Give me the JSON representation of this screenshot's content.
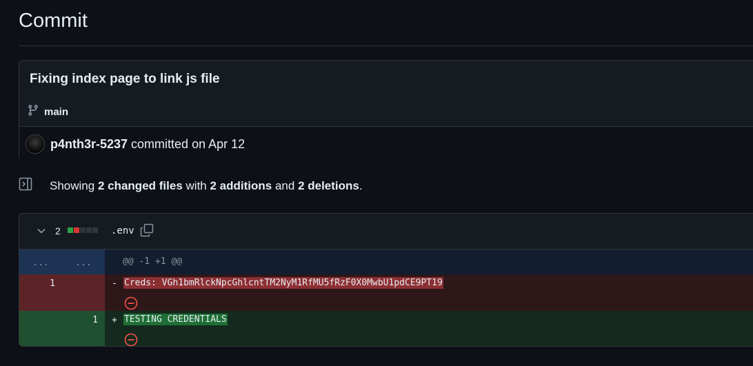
{
  "page": {
    "title": "Commit"
  },
  "commit": {
    "message": "Fixing index page to link js file",
    "branch": "main",
    "author": "p4nth3r-5237",
    "committed_text": "committed on Apr 12"
  },
  "summary": {
    "prefix": "Showing",
    "changed_files": "2 changed files",
    "with": "with",
    "additions": "2 additions",
    "and": "and",
    "deletions": "2 deletions",
    "end": "."
  },
  "file": {
    "change_count": "2",
    "name": ".env",
    "diffstat": [
      "added",
      "deleted",
      "neutral",
      "neutral",
      "neutral"
    ],
    "hunk": {
      "old_ln": "...",
      "new_ln": "...",
      "header": "@@ -1 +1 @@"
    },
    "lines": [
      {
        "type": "deleted",
        "old_ln": "1",
        "new_ln": "",
        "marker": "-",
        "text": "Creds: VGh1bmRlckNpcGhlcntTM2NyM1RfMU5fRzF0X0MwbU1pdCE9PT19"
      },
      {
        "type": "added",
        "old_ln": "",
        "new_ln": "1",
        "marker": "+",
        "text": "TESTING CREDENTIALS"
      }
    ]
  },
  "colors": {
    "added": "#2ea043",
    "deleted": "#da3633",
    "neutral": "#30363d",
    "accent": "#f85149"
  }
}
